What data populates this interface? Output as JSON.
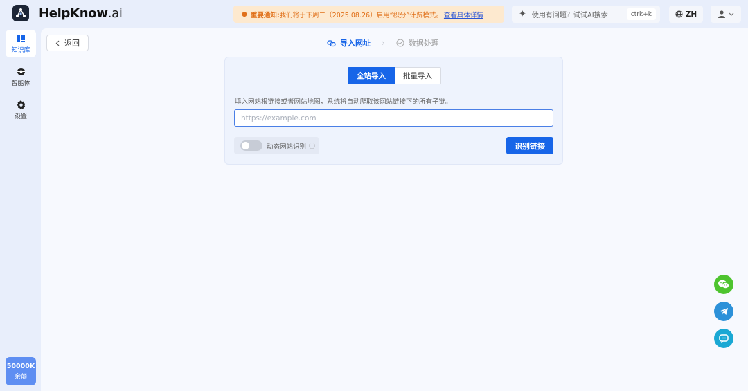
{
  "brand": {
    "name": "HelpKnow",
    "suffix": ".ai"
  },
  "notice": {
    "title": "重要通知:",
    "message": " 我们将于下周二（2025.08.26）启用“积分”计费模式。",
    "link": "查看具体详情"
  },
  "search": {
    "placeholder": "使用有问题？试试AI搜索",
    "shortcut": "ctrk+k"
  },
  "language": {
    "label": "ZH"
  },
  "sidebar": {
    "items": [
      {
        "label": "知识库",
        "icon": "book-icon",
        "active": true
      },
      {
        "label": "智能体",
        "icon": "agent-icon",
        "active": false
      },
      {
        "label": "设置",
        "icon": "gear-icon",
        "active": false
      }
    ],
    "balance": {
      "amount": "50000K",
      "label": "余额"
    }
  },
  "main": {
    "back_label": "返回",
    "steps": [
      {
        "label": "导入网址",
        "active": true
      },
      {
        "label": "数据处理",
        "active": false
      }
    ],
    "tabs": [
      {
        "label": "全站导入",
        "active": true
      },
      {
        "label": "批量导入",
        "active": false
      }
    ],
    "hint": "填入网站根链接或者网站地图，系统将自动爬取该网站链接下的所有子链。",
    "url_input": {
      "value": "",
      "placeholder": "https://example.com"
    },
    "toggle": {
      "label": "动态网站识别",
      "on": false
    },
    "detect_button": "识别链接"
  },
  "colors": {
    "primary": "#1765e8",
    "notice_bg": "#fde9cf",
    "notice_text": "#e0701a"
  }
}
